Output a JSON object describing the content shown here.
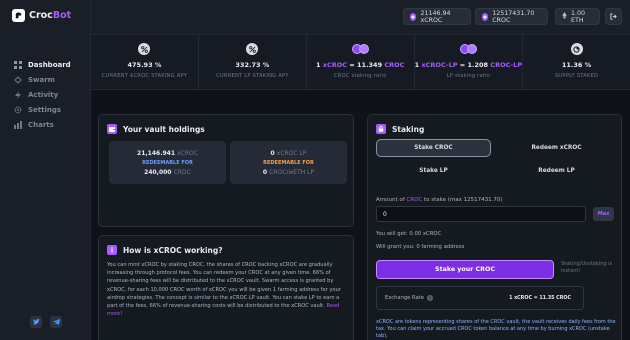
{
  "brand": {
    "name_main": "Croc",
    "name_accent": "Bot"
  },
  "nav": [
    {
      "label": "Dashboard",
      "icon": "dashboard-icon",
      "active": true
    },
    {
      "label": "Swarm",
      "icon": "swarm-icon",
      "active": false
    },
    {
      "label": "Activity",
      "icon": "activity-icon",
      "active": false
    },
    {
      "label": "Settings",
      "icon": "settings-icon",
      "active": false
    },
    {
      "label": "Charts",
      "icon": "charts-icon",
      "active": false
    }
  ],
  "topbar": {
    "xcroc_balance": "21146.94 xCROC",
    "croc_balance": "12517431.70 CROC",
    "eth_balance": "1.00 ETH"
  },
  "stats": [
    {
      "value": "475.93 %",
      "label": "CURRENT $CROC STAKING APY",
      "icon": "percent-icon"
    },
    {
      "value": "332.73 %",
      "label": "CURRENT LP STAKING APY",
      "icon": "percent-icon"
    },
    {
      "value_prefix": "1 ",
      "value_acc1": "xCROC",
      "value_mid": " = 11.349 ",
      "value_acc2": "CROC",
      "label": "CROC staking ratio",
      "icon": "coin-pair-icon"
    },
    {
      "value_prefix": "1 ",
      "value_acc1": "xCROC-LP",
      "value_mid": " = 1.208 ",
      "value_acc2": "CROC-LP",
      "label": "LP staking ratio",
      "icon": "coin-pair-icon"
    },
    {
      "value": "11.36 %",
      "label": "SUPPLY STAKED",
      "icon": "pie-icon"
    }
  ],
  "holdings": {
    "title": "Your vault holdings",
    "left": {
      "amount": "21,146.941",
      "unit": "xCROC",
      "redeem_label": "REDEEMABLE FOR",
      "redeem_amount": "240,000",
      "redeem_unit": "CROC"
    },
    "right": {
      "amount": "0",
      "unit": "xCROC LP",
      "redeem_label": "REDEEMABLE FOR",
      "redeem_amount": "0",
      "redeem_unit": "CROC/wETH LP"
    }
  },
  "how": {
    "title": "How is xCROC working?",
    "text": "You can mint xCROC by staking CROC, the shares of CROC backing xCROC are gradually increasing through protocol fees. You can redeem your CROC at any given time. 66% of revenue-sharing fees will be distributed to the xCROC vault. Swarm access is granted by xCROC, for each 10,000 CROC worth of xCROC you will be given 1 farming address for your airdrop strategies. The concept is similar to the xCROC LP vault. You can stake LP to earn a part of the fees, 66% of revenue-sharing costs will be distributed to the xCROC vault.",
    "read_more": "Read more!"
  },
  "staking": {
    "title": "Staking",
    "tabs": [
      "Stake CROC",
      "Redeem xCROC",
      "Stake LP",
      "Redeem LP"
    ],
    "amount_label_pre": "Amount of ",
    "amount_label_acc": "CROC",
    "amount_label_post": " to stake (max 12517431.70)",
    "amount_value": "0",
    "max_label": "Max",
    "will_get": "You will get: 0.00 xCROC",
    "will_grant": "Will grant you: 0 farming address",
    "stake_button": "Stake your CROC",
    "hint": "Staking/Unstaking is instant!",
    "exchange_label": "Exchange Rate",
    "exchange_rate": "1 xCROC = 11.35 CROC",
    "info": "xCROC are tokens representing shares of the CROC vault, the vault receives daily fees from the tax. You can claim your accrued CROC token balance at any time by burning xCROC (unstake tab)."
  },
  "colors": {
    "accent": "#a75cff",
    "background": "#0f1218",
    "panel": "#151920"
  }
}
